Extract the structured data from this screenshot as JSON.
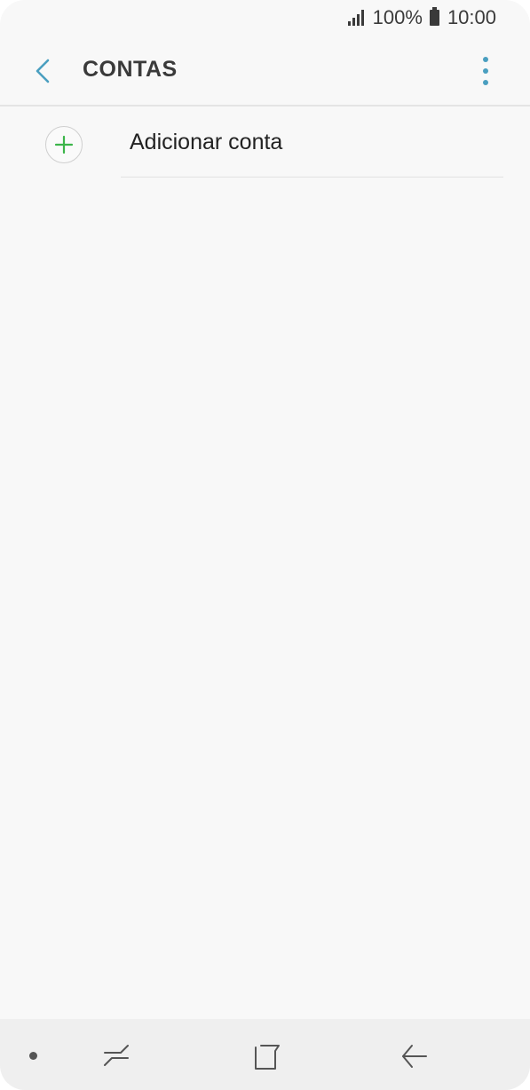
{
  "status_bar": {
    "battery": "100%",
    "time": "10:00",
    "icons": [
      "signal-icon",
      "battery-icon"
    ]
  },
  "app_bar": {
    "title": "CONTAS",
    "back_icon": "back-arrow-icon",
    "menu_icon": "more-vert-icon"
  },
  "accounts_list": {
    "items": [
      {
        "label": "Adicionar conta",
        "icon": "add-circle-icon"
      }
    ]
  },
  "nav_bar": {
    "buttons": [
      "nav-dot",
      "recents-icon",
      "home-icon",
      "back-icon"
    ]
  },
  "colors": {
    "accent": "#4a9fc0",
    "add_icon": "#3cb54a",
    "background": "#f8f8f8",
    "nav_background": "#efefef"
  }
}
